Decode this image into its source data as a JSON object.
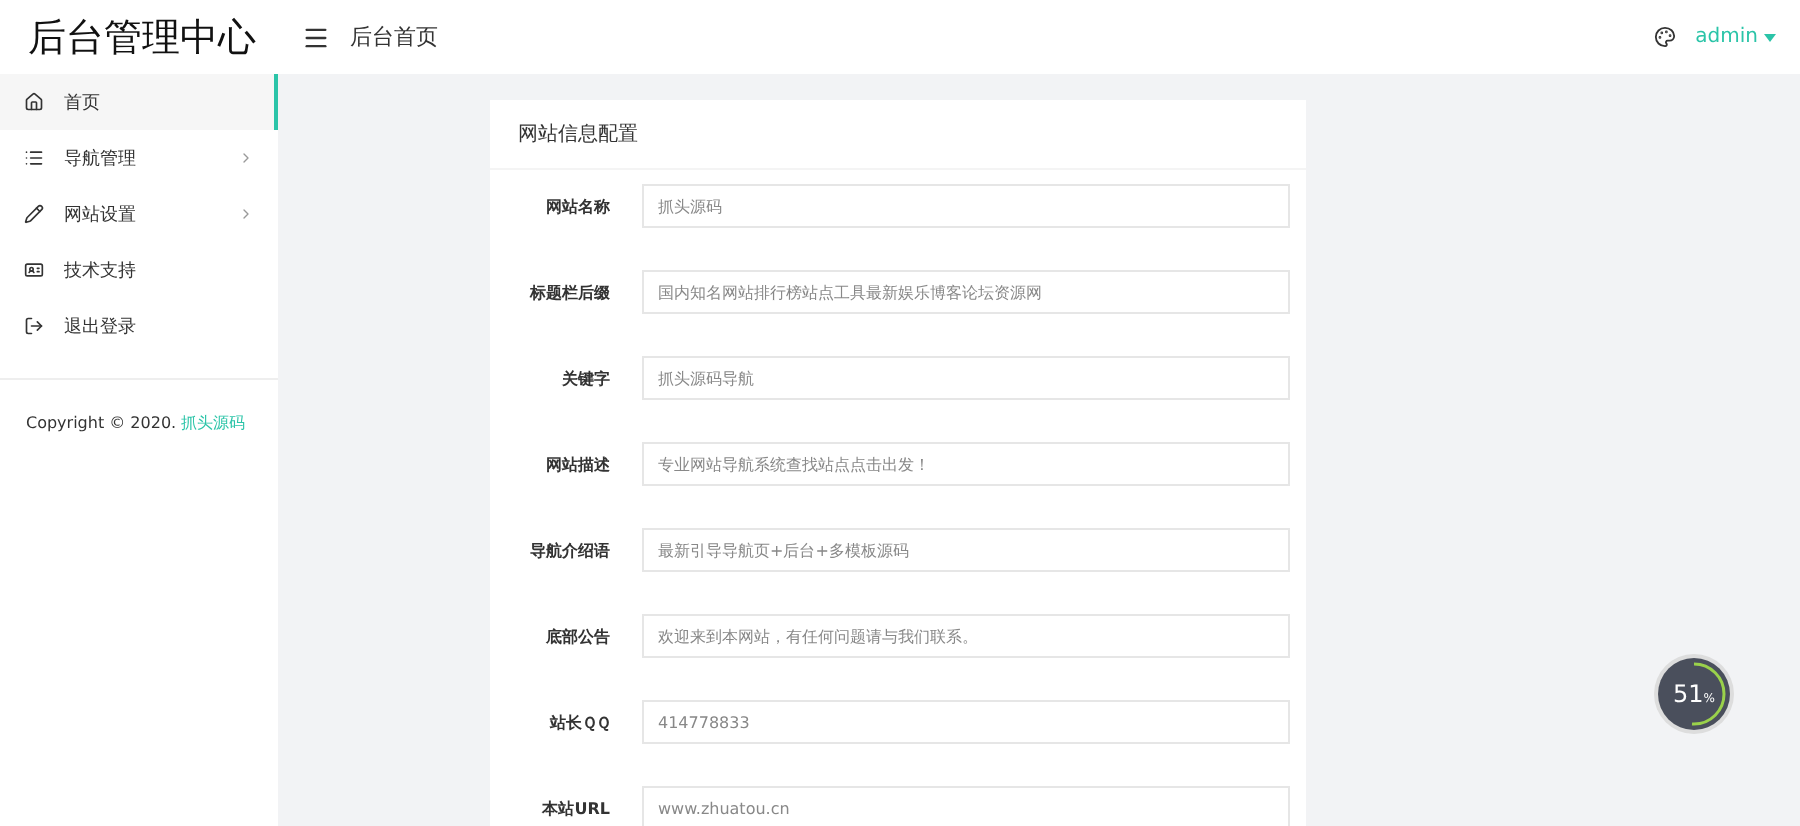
{
  "brand": "后台管理中心",
  "header": {
    "breadcrumb": "后台首页",
    "user": "admin"
  },
  "sidebar": {
    "items": [
      {
        "label": "首页",
        "selected": true,
        "expandable": false
      },
      {
        "label": "导航管理",
        "selected": false,
        "expandable": true
      },
      {
        "label": "网站设置",
        "selected": false,
        "expandable": true
      },
      {
        "label": "技术支持",
        "selected": false,
        "expandable": false
      },
      {
        "label": "退出登录",
        "selected": false,
        "expandable": false
      }
    ],
    "copyright": "Copyright © 2020.",
    "copyright_link": "抓头源码"
  },
  "form": {
    "title": "网站信息配置",
    "fields": [
      {
        "label": "网站名称",
        "value": "抓头源码"
      },
      {
        "label": "标题栏后缀",
        "value": "国内知名网站排行榜站点工具最新娱乐博客论坛资源网"
      },
      {
        "label": "关键字",
        "value": "抓头源码导航"
      },
      {
        "label": "网站描述",
        "value": "专业网站导航系统查找站点点击出发！"
      },
      {
        "label": "导航介绍语",
        "value": "最新引导导航页+后台+多模板源码"
      },
      {
        "label": "底部公告",
        "value": "欢迎来到本网站，有任何问题请与我们联系。"
      },
      {
        "label": "站长ＱＱ",
        "value": "414778833"
      },
      {
        "label": "本站URL",
        "value": "www.zhuatou.cn"
      }
    ]
  },
  "gauge": {
    "reading": "51",
    "unit": "%"
  }
}
